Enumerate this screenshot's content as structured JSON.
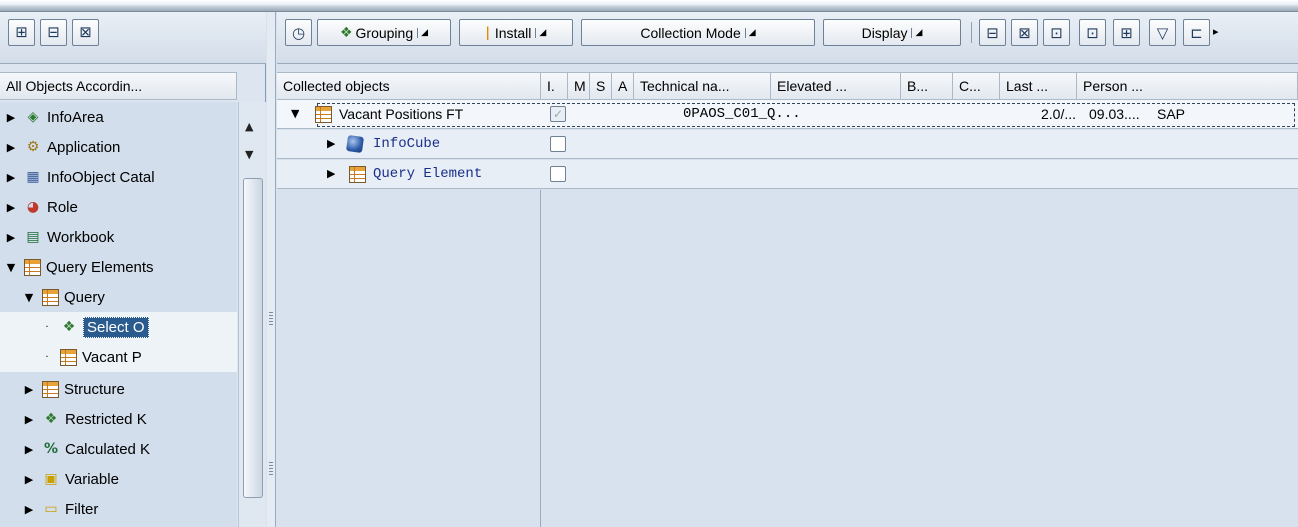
{
  "left_toolbar": {
    "buttons": [
      {
        "icon": "hierarchy-icon",
        "glyph": "⊞"
      },
      {
        "icon": "find-icon",
        "glyph": "⊟"
      },
      {
        "icon": "find-next-icon",
        "glyph": "⊠"
      }
    ]
  },
  "tree": {
    "header": "All Objects Accordin...",
    "items": [
      {
        "label": "InfoArea",
        "icon": "infoarea-icon",
        "glyph": "◈",
        "expander": "▶"
      },
      {
        "label": "Application",
        "icon": "application-icon",
        "glyph": "⚙",
        "expander": "▶"
      },
      {
        "label": "InfoObject Catal",
        "icon": "infoobject-catalog-icon",
        "glyph": "▦",
        "expander": "▶"
      },
      {
        "label": "Role",
        "icon": "role-icon",
        "glyph": "◕",
        "expander": "▶"
      },
      {
        "label": "Workbook",
        "icon": "workbook-icon",
        "glyph": "▤",
        "expander": "▶"
      },
      {
        "label": "Query Elements",
        "icon": "query-elements-icon",
        "expander": "▼"
      },
      {
        "label": "Query",
        "icon": "query-icon",
        "expander": "▼"
      },
      {
        "label": "Select O",
        "icon": "select-option-icon",
        "glyph": "❖",
        "expander": "·"
      },
      {
        "label": "Vacant P",
        "icon": "vacant-positions-icon",
        "expander": "·"
      },
      {
        "label": "Structure",
        "icon": "structure-icon",
        "expander": "▶"
      },
      {
        "label": "Restricted K",
        "icon": "restricted-key-figure-icon",
        "glyph": "❖",
        "expander": "▶"
      },
      {
        "label": "Calculated K",
        "icon": "calculated-key-figure-icon",
        "glyph": "%",
        "expander": "▶"
      },
      {
        "label": "Variable",
        "icon": "variable-icon",
        "glyph": "▣",
        "expander": "▶"
      },
      {
        "label": "Filter",
        "icon": "filter-icon",
        "glyph": "▭",
        "expander": "▶"
      }
    ]
  },
  "right_toolbar": {
    "clock_glyph": "◷",
    "grouping": "Grouping",
    "install": "Install",
    "collection_mode": "Collection Mode",
    "display": "Display",
    "dropdown_glyph": "◢",
    "icon_buttons": [
      {
        "icon": "find-icon",
        "glyph": "⊟"
      },
      {
        "icon": "find-next-icon",
        "glyph": "⊠"
      },
      {
        "icon": "transfer-icon",
        "glyph": "⊡"
      },
      {
        "icon": "transfer-all-icon",
        "glyph": "⊡"
      },
      {
        "icon": "expand-icon",
        "glyph": "⊞"
      },
      {
        "icon": "filter-icon",
        "glyph": "▽"
      },
      {
        "icon": "layout-icon",
        "glyph": "⊏"
      }
    ],
    "more_glyph": "▸"
  },
  "grid": {
    "columns": [
      "Collected objects",
      "I.",
      "M",
      "S",
      "A",
      "Technical na...",
      "Elevated ...",
      "B...",
      "C...",
      "Last ...",
      "Person ..."
    ],
    "rows": [
      {
        "name": "Vacant Positions FT",
        "expander": "▼",
        "checked": "✓",
        "technical": "0PAOS_C01_Q...",
        "c": "2.0/...",
        "last": "09.03....",
        "person": "SAP"
      },
      {
        "name": "InfoCube",
        "expander": "▶"
      },
      {
        "name": "Query Element",
        "expander": "▶"
      }
    ]
  },
  "scroll": {
    "up": "▲",
    "down": "▼"
  }
}
